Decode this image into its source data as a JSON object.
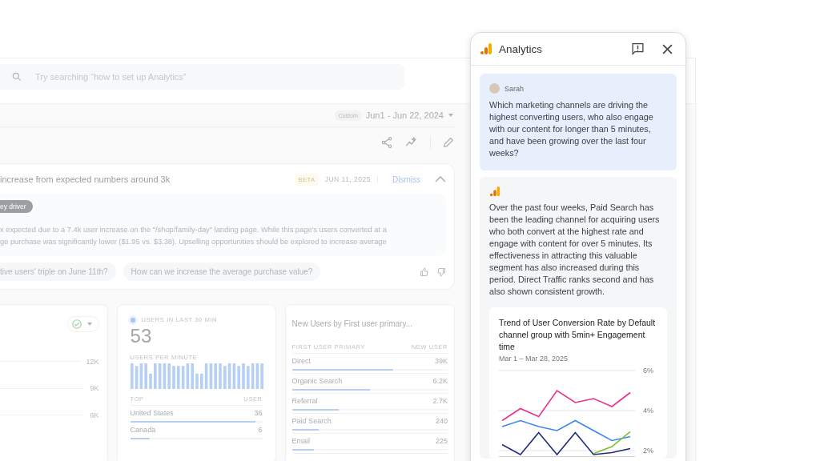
{
  "search": {
    "placeholder": "Try searching “how to set up Analytics”"
  },
  "date_range": {
    "chip": "Custom",
    "label": "Jun1 - Jun 22, 2024"
  },
  "insight": {
    "title": "increase from expected numbers around 3k",
    "badge": "BETA",
    "date": "JUN 11, 2025",
    "dismiss": "Dismiss",
    "tag": "ey driver",
    "lines": [
      "x expected due to a 7.4k user increase on the \"/shop/family-day\" landing page. While this page's users converted at a",
      "ge purchase was significantly lower ($1.95 vs. $3.38).  Upselling opportunities should be explored to increase average"
    ],
    "suggestions": [
      "tive users' triple on June 11th?",
      "How can we increase the average purchase value?"
    ]
  },
  "trend_card": {
    "yticks": [
      "12K",
      "9K",
      "6K"
    ]
  },
  "realtime": {
    "title": "USERS IN LAST 30 MIN",
    "value": "53",
    "subtitle": "USERS PER MINUTE",
    "col_1": "TOP",
    "col_2": "USER",
    "rows": [
      {
        "label": "United States",
        "value": "36",
        "level": 0.95
      },
      {
        "label": "Canada",
        "value": "6",
        "level": 0.15
      }
    ]
  },
  "new_users": {
    "title": "New Users by First user primary...",
    "col_1": "FIRST USER PRIMARY",
    "col_2": "NEW USER",
    "rows": [
      {
        "label": "Direct",
        "value": "39K",
        "level": 0.65
      },
      {
        "label": "Organic Search",
        "value": "6.2K",
        "level": 0.5
      },
      {
        "label": "Referral",
        "value": "2.7K",
        "level": 0.3
      },
      {
        "label": "Paid Search",
        "value": "240",
        "level": 0.17
      },
      {
        "label": "Email",
        "value": "225",
        "level": 0.14
      }
    ]
  },
  "panel": {
    "title": "Analytics",
    "messages": [
      {
        "kind": "user",
        "author": "Sarah",
        "text": "Which marketing channels are driving the highest converting users, who also engage with our content for longer than 5 minutes, and have been growing over the last four weeks?"
      },
      {
        "kind": "assistant",
        "text": "Over the past four weeks, Paid Search has been the leading channel for acquiring users who both convert at the highest rate and engage with content for over 5 minutes. Its effectiveness in attracting this valuable segment has also increased during this period. Direct Traffic ranks second and has also shown consistent growth.",
        "chart": {
          "subtitle": "Mar 1 – Mar 28, 2025",
          "chart_data": {
            "type": "line",
            "title": "Trend of User Conversion Rate by Default channel group with 5min+ Engagement time",
            "ylim": [
              1.7,
              6
            ],
            "yticks": [
              {
                "value": 6,
                "label": "6%"
              },
              {
                "value": 4,
                "label": "4%"
              },
              {
                "value": 2,
                "label": "2%"
              }
            ],
            "series": [
              {
                "color": "#e8308c",
                "values": [
                  3.5,
                  4.1,
                  3.7,
                  5.0,
                  4.4,
                  4.6,
                  4.2,
                  4.9
                ]
              },
              {
                "color": "#3b86f0",
                "values": [
                  3.2,
                  3.5,
                  3.2,
                  3.0,
                  3.5,
                  3.0,
                  2.5,
                  2.7
                ]
              },
              {
                "color": "#1f2a7a",
                "values": [
                  2.3,
                  1.8,
                  2.9,
                  1.8,
                  2.9,
                  1.8,
                  1.9,
                  2.1
                ]
              },
              {
                "color": "#7cbf3a",
                "values": [
                  null,
                  null,
                  null,
                  null,
                  null,
                  1.85,
                  2.2,
                  2.95
                ]
              }
            ]
          }
        }
      }
    ]
  }
}
